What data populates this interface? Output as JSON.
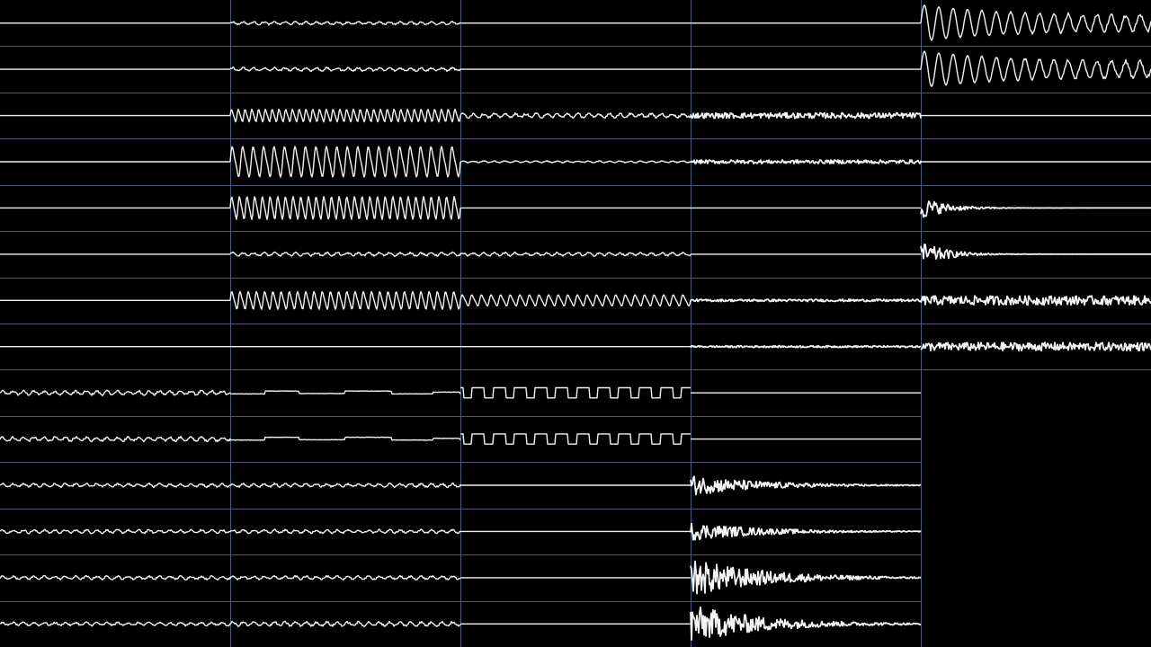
{
  "colors": {
    "background": "#000000",
    "grid": "#4a5a7a",
    "trace": "#f2f2f2"
  },
  "channels": [
    {
      "col": 0,
      "row": 0,
      "type": "flat",
      "amp": 0
    },
    {
      "col": 0,
      "row": 1,
      "type": "flat",
      "amp": 0
    },
    {
      "col": 0,
      "row": 2,
      "type": "flat",
      "amp": 0
    },
    {
      "col": 0,
      "row": 3,
      "type": "flat",
      "amp": 0
    },
    {
      "col": 0,
      "row": 4,
      "type": "flat",
      "amp": 0
    },
    {
      "col": 0,
      "row": 5,
      "type": "flat",
      "amp": 0
    },
    {
      "col": 0,
      "row": 6,
      "type": "flat",
      "amp": 0
    },
    {
      "col": 0,
      "row": 7,
      "type": "flat",
      "amp": 0
    },
    {
      "col": 0,
      "row": 8,
      "type": "ripple",
      "amp": 0.15
    },
    {
      "col": 0,
      "row": 9,
      "type": "ripple",
      "amp": 0.15
    },
    {
      "col": 0,
      "row": 10,
      "type": "ripple",
      "amp": 0.12
    },
    {
      "col": 0,
      "row": 11,
      "type": "ripple",
      "amp": 0.12
    },
    {
      "col": 0,
      "row": 12,
      "type": "ripple",
      "amp": 0.12
    },
    {
      "col": 0,
      "row": 13,
      "type": "ripple",
      "amp": 0.12
    },
    {
      "col": 1,
      "row": 0,
      "type": "ripple",
      "amp": 0.1
    },
    {
      "col": 1,
      "row": 1,
      "type": "ripple",
      "amp": 0.12
    },
    {
      "col": 1,
      "row": 2,
      "type": "sine",
      "amp": 0.25,
      "cycles": 34
    },
    {
      "col": 1,
      "row": 3,
      "type": "sine",
      "amp": 0.6,
      "cycles": 22
    },
    {
      "col": 1,
      "row": 4,
      "type": "sine",
      "amp": 0.45,
      "cycles": 30
    },
    {
      "col": 1,
      "row": 5,
      "type": "ripple",
      "amp": 0.12
    },
    {
      "col": 1,
      "row": 6,
      "type": "sine",
      "amp": 0.35,
      "cycles": 28
    },
    {
      "col": 1,
      "row": 7,
      "type": "flat",
      "amp": 0
    },
    {
      "col": 1,
      "row": 8,
      "type": "step",
      "amp": 0.15
    },
    {
      "col": 1,
      "row": 9,
      "type": "step",
      "amp": 0.15
    },
    {
      "col": 1,
      "row": 10,
      "type": "ripple",
      "amp": 0.12
    },
    {
      "col": 1,
      "row": 11,
      "type": "ripple",
      "amp": 0.12
    },
    {
      "col": 1,
      "row": 12,
      "type": "ripple",
      "amp": 0.12
    },
    {
      "col": 1,
      "row": 13,
      "type": "ripple",
      "amp": 0.15
    },
    {
      "col": 2,
      "row": 0,
      "type": "flat",
      "amp": 0
    },
    {
      "col": 2,
      "row": 1,
      "type": "flat",
      "amp": 0
    },
    {
      "col": 2,
      "row": 2,
      "type": "ripple",
      "amp": 0.15
    },
    {
      "col": 2,
      "row": 3,
      "type": "ripple",
      "amp": 0.06
    },
    {
      "col": 2,
      "row": 4,
      "type": "flat",
      "amp": 0
    },
    {
      "col": 2,
      "row": 5,
      "type": "ripple",
      "amp": 0.12
    },
    {
      "col": 2,
      "row": 6,
      "type": "sine",
      "amp": 0.22,
      "cycles": 24
    },
    {
      "col": 2,
      "row": 7,
      "type": "flat",
      "amp": 0
    },
    {
      "col": 2,
      "row": 8,
      "type": "pulse",
      "amp": 0.22,
      "cycles": 11
    },
    {
      "col": 2,
      "row": 9,
      "type": "pulse",
      "amp": 0.22,
      "cycles": 11
    },
    {
      "col": 2,
      "row": 10,
      "type": "flat",
      "amp": 0
    },
    {
      "col": 2,
      "row": 11,
      "type": "flat",
      "amp": 0
    },
    {
      "col": 2,
      "row": 12,
      "type": "flat",
      "amp": 0
    },
    {
      "col": 2,
      "row": 13,
      "type": "flat",
      "amp": 0
    },
    {
      "col": 3,
      "row": 0,
      "type": "flat",
      "amp": 0
    },
    {
      "col": 3,
      "row": 1,
      "type": "flat",
      "amp": 0
    },
    {
      "col": 3,
      "row": 2,
      "type": "noise",
      "amp": 0.12
    },
    {
      "col": 3,
      "row": 3,
      "type": "noise",
      "amp": 0.08
    },
    {
      "col": 3,
      "row": 4,
      "type": "flat",
      "amp": 0
    },
    {
      "col": 3,
      "row": 5,
      "type": "flat",
      "amp": 0
    },
    {
      "col": 3,
      "row": 6,
      "type": "noise",
      "amp": 0.05
    },
    {
      "col": 3,
      "row": 7,
      "type": "noise",
      "amp": 0.04
    },
    {
      "col": 3,
      "row": 8,
      "type": "flat",
      "amp": 0
    },
    {
      "col": 3,
      "row": 9,
      "type": "flat",
      "amp": 0
    },
    {
      "col": 3,
      "row": 10,
      "type": "decay",
      "amp": 0.45
    },
    {
      "col": 3,
      "row": 11,
      "type": "decay",
      "amp": 0.4
    },
    {
      "col": 3,
      "row": 12,
      "type": "decay",
      "amp": 0.85
    },
    {
      "col": 3,
      "row": 13,
      "type": "decay",
      "amp": 0.85
    },
    {
      "col": 4,
      "row": 0,
      "type": "decaysine",
      "amp": 0.8,
      "cycles": 16
    },
    {
      "col": 4,
      "row": 1,
      "type": "decaysine",
      "amp": 0.8,
      "cycles": 16
    },
    {
      "col": 4,
      "row": 2,
      "type": "flat",
      "amp": 0
    },
    {
      "col": 4,
      "row": 3,
      "type": "flat",
      "amp": 0
    },
    {
      "col": 4,
      "row": 4,
      "type": "burst",
      "amp": 0.5
    },
    {
      "col": 4,
      "row": 5,
      "type": "burst",
      "amp": 0.55
    },
    {
      "col": 4,
      "row": 6,
      "type": "noise",
      "amp": 0.2
    },
    {
      "col": 4,
      "row": 7,
      "type": "noise",
      "amp": 0.18
    }
  ]
}
